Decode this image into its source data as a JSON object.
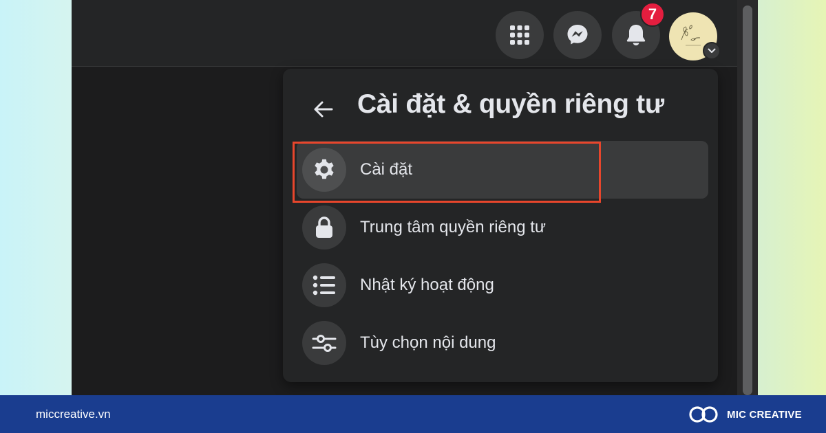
{
  "header": {
    "notification_count": "7",
    "icons": [
      "menu-grid-icon",
      "messenger-icon",
      "bell-icon",
      "avatar",
      "chevron-down-icon"
    ]
  },
  "menu": {
    "title": "Cài đặt & quyền riêng tư",
    "items": [
      {
        "label": "Cài đặt",
        "icon": "gear-icon"
      },
      {
        "label": "Trung tâm quyền riêng tư",
        "icon": "lock-icon"
      },
      {
        "label": "Nhật ký hoạt động",
        "icon": "list-icon"
      },
      {
        "label": "Tùy chọn nội dung",
        "icon": "sliders-icon"
      }
    ]
  },
  "footer": {
    "url": "miccreative.vn",
    "brand": "MIC CREATIVE"
  },
  "colors": {
    "highlight": "#e8462c",
    "badge": "#e41e3f",
    "footer_bg": "#1a3d8f"
  }
}
